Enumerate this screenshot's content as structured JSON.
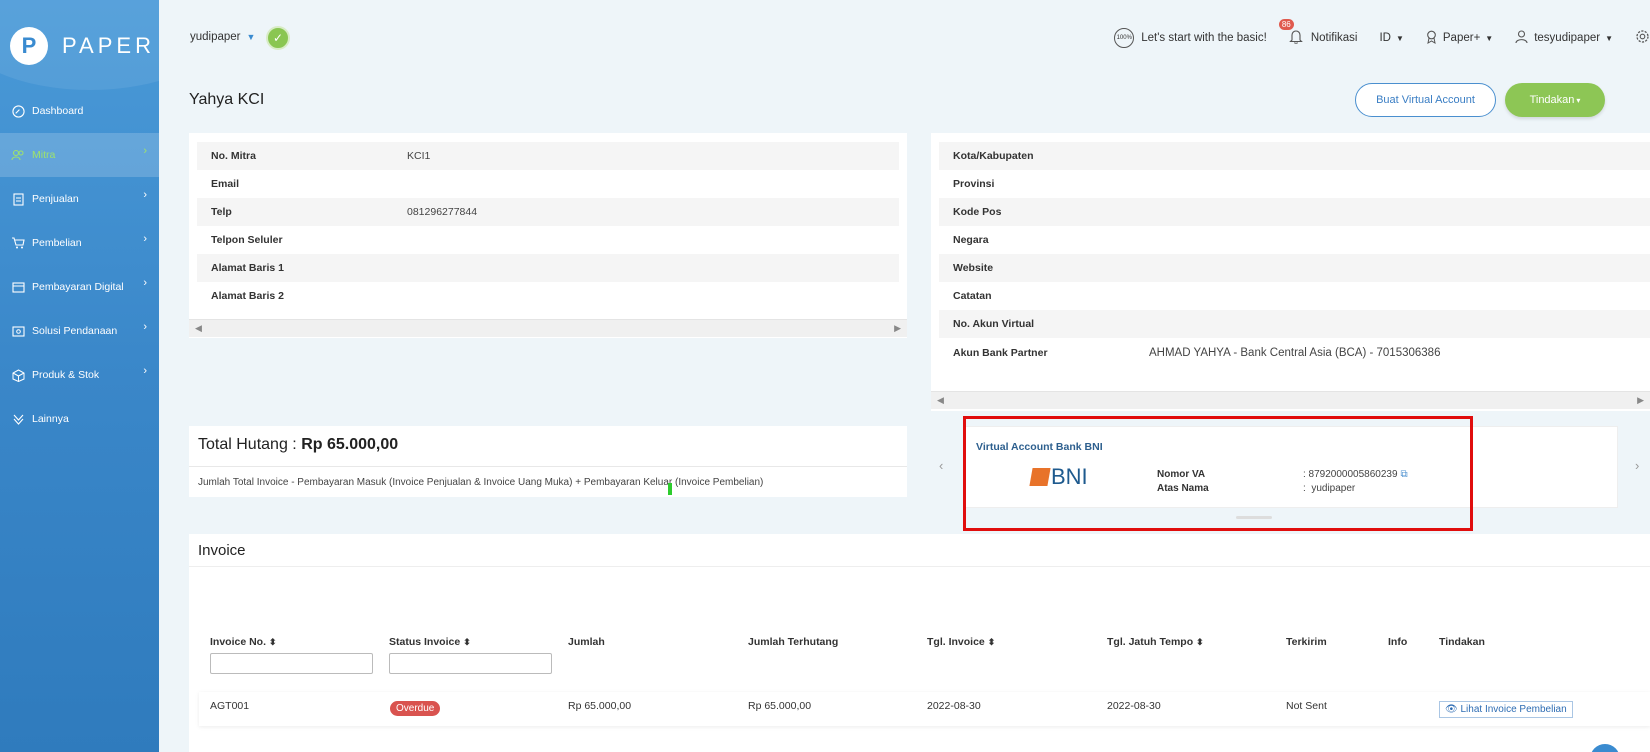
{
  "brand": {
    "name": "PAPER",
    "logo_letter": "P"
  },
  "sidebar": {
    "items": [
      {
        "label": "Dashboard",
        "icon": "dashboard-icon"
      },
      {
        "label": "Mitra",
        "icon": "users-icon",
        "active": true
      },
      {
        "label": "Penjualan",
        "icon": "document-icon"
      },
      {
        "label": "Pembelian",
        "icon": "cart-icon"
      },
      {
        "label": "Pembayaran Digital",
        "icon": "card-icon"
      },
      {
        "label": "Solusi Pendanaan",
        "icon": "money-icon"
      },
      {
        "label": "Produk & Stok",
        "icon": "box-icon"
      },
      {
        "label": "Lainnya",
        "icon": "more-icon"
      }
    ]
  },
  "header": {
    "company": "yudipaper",
    "onboarding": "Let's start with the basic!",
    "onboarding_badge": "100%",
    "notif_count": "86",
    "notif_label": "Notifikasi",
    "language": "ID",
    "plan": "Paper+",
    "user": "tesyudipaper"
  },
  "page": {
    "title": "Yahya KCI",
    "btn_va": "Buat Virtual Account",
    "btn_action": "Tindakan"
  },
  "left_info": [
    {
      "k": "No. Mitra",
      "v": "KCI1"
    },
    {
      "k": "Email",
      "v": ""
    },
    {
      "k": "Telp",
      "v": "081296277844"
    },
    {
      "k": "Telpon Seluler",
      "v": ""
    },
    {
      "k": "Alamat Baris 1",
      "v": ""
    },
    {
      "k": "Alamat Baris 2",
      "v": ""
    }
  ],
  "right_info": [
    {
      "k": "Kota/Kabupaten",
      "v": ""
    },
    {
      "k": "Provinsi",
      "v": ""
    },
    {
      "k": "Kode Pos",
      "v": ""
    },
    {
      "k": "Negara",
      "v": ""
    },
    {
      "k": "Website",
      "v": ""
    },
    {
      "k": "Catatan",
      "v": ""
    },
    {
      "k": "No. Akun Virtual",
      "v": ""
    },
    {
      "k": "Akun Bank Partner",
      "v": "AHMAD YAHYA - Bank Central Asia (BCA) - 7015306386"
    }
  ],
  "hutang": {
    "label": "Total Hutang",
    "separator": " : ",
    "amount": "Rp 65.000,00",
    "note": "Jumlah Total Invoice - Pembayaran Masuk (Invoice Penjualan & Invoice Uang Muka) + Pembayaran Keluar (Invoice Pembelian)"
  },
  "va": {
    "title": "Virtual Account Bank BNI",
    "bank_logo": "BNI",
    "nomor_label": "Nomor VA",
    "nomor_value": ": 8792000005860239",
    "atas_label": "Atas Nama",
    "atas_value": ":  yudipaper"
  },
  "invoice": {
    "title": "Invoice",
    "columns": [
      "Invoice No.",
      "Status Invoice",
      "Jumlah",
      "Jumlah Terhutang",
      "Tgl. Invoice",
      "Tgl. Jatuh Tempo",
      "Terkirim",
      "Info",
      "Tindakan"
    ],
    "row": {
      "no": "AGT001",
      "status": "Overdue",
      "jumlah": "Rp 65.000,00",
      "terhutang": "Rp 65.000,00",
      "tgl_invoice": "2022-08-30",
      "tgl_jatuh_tempo": "2022-08-30",
      "terkirim": "Not Sent",
      "info": "",
      "action": "Lihat Invoice Pembelian"
    }
  }
}
